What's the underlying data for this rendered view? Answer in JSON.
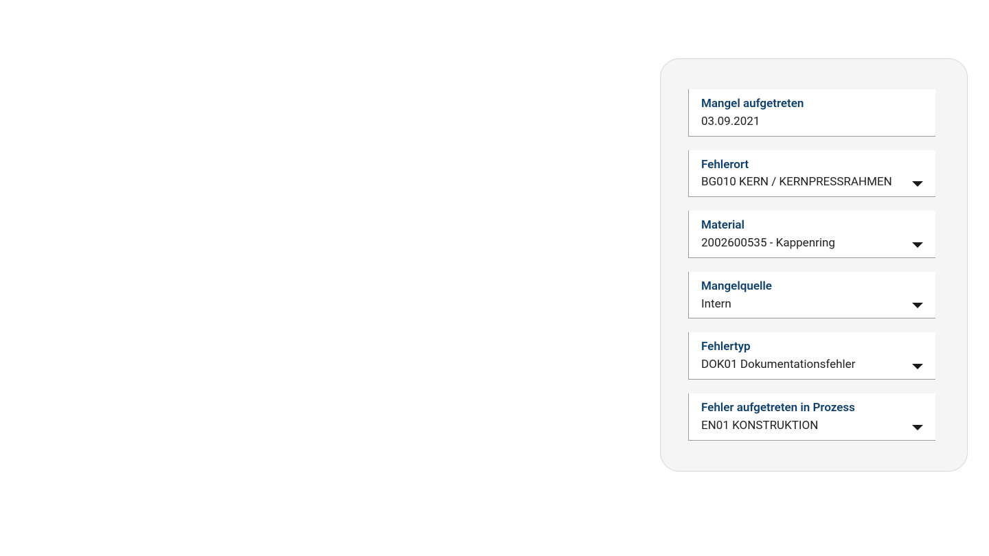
{
  "fields": {
    "mangelAufgetreten": {
      "label": "Mangel aufgetreten",
      "value": "03.09.2021"
    },
    "fehlerort": {
      "label": "Fehlerort",
      "value": "BG010 KERN / KERNPRESSRAHMEN"
    },
    "material": {
      "label": "Material",
      "value": "2002600535 - Kappenring"
    },
    "mangelquelle": {
      "label": "Mangelquelle",
      "value": "Intern"
    },
    "fehlertyp": {
      "label": "Fehlertyp",
      "value": "DOK01 Dokumentationsfehler"
    },
    "fehlerProzess": {
      "label": "Fehler aufgetreten in Prozess",
      "value": "EN01 KONSTRUKTION"
    }
  }
}
